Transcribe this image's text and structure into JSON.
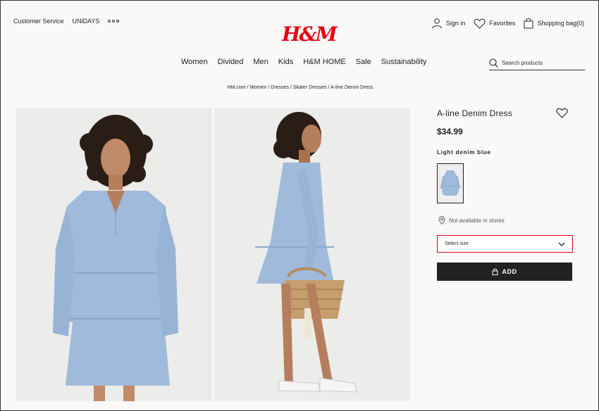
{
  "header": {
    "utility_left": [
      "Customer Service",
      "UNiDAYS"
    ],
    "logo_text": "H&M",
    "sign_in": "Sign in",
    "favorites": "Favorites",
    "shopping_bag": "Shopping bag(0)"
  },
  "nav": {
    "items": [
      "Women",
      "Divided",
      "Men",
      "Kids",
      "H&M HOME",
      "Sale",
      "Sustainability"
    ],
    "search_placeholder": "Search products"
  },
  "breadcrumb": "HM.com / Women / Dresses / Skater Dresses / A-line Denim Dress",
  "product": {
    "title": "A-line Denim Dress",
    "price": "$34.99",
    "color_name": "Light denim blue",
    "availability": "Not available in stores",
    "size_placeholder": "Select size",
    "add_label": "ADD"
  },
  "colors": {
    "brand_red": "#e50010",
    "denim_light": "#a7c0dc",
    "denim_mid": "#8eabcf",
    "button_dark": "#222222",
    "select_border": "#d6001c"
  },
  "icons": [
    "dots-icon",
    "user-icon",
    "heart-icon",
    "bag-icon",
    "search-icon",
    "location-pin-icon",
    "chevron-down-icon",
    "lock-bag-icon"
  ]
}
